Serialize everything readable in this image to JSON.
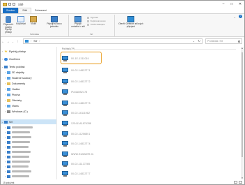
{
  "window": {
    "title": "Sítě"
  },
  "ribbon": {
    "tabs": [
      "Soubor",
      "Sítě",
      "Zobrazení"
    ],
    "buttons": {
      "pin": "Připnout k panelu Rychlý přístup",
      "copy": "Kopírovat",
      "paste": "Vložit",
      "map": "Připojit síťovou jednotku",
      "map2": "Připojit umístění v síti",
      "properties": "Vlastnosti",
      "network": "Otevřít Centrum síťových připojení"
    },
    "small_items": [
      "Vyjmout",
      "Kopírovat cestu",
      "Vložit zástupce"
    ],
    "groups": [
      "Schránka",
      "Síť"
    ]
  },
  "address": {
    "path": "Síť",
    "search_placeholder": "Prohledat: Síť"
  },
  "nav": {
    "items": [
      {
        "label": "Rychlý přístup",
        "icon": "star-icon"
      },
      {
        "label": "OneDrive",
        "icon": "cloud-icon"
      },
      {
        "label": "Tento počítač",
        "icon": "computer-icon"
      },
      {
        "label": "3D objekty",
        "icon": "folder-icon"
      },
      {
        "label": "Stažené soubory",
        "icon": "download-folder-icon"
      },
      {
        "label": "Dokumenty",
        "icon": "documents-folder-icon"
      },
      {
        "label": "Hudba",
        "icon": "music-folder-icon"
      },
      {
        "label": "Plocha",
        "icon": "desktop-folder-icon"
      },
      {
        "label": "Obrázky",
        "icon": "pictures-folder-icon"
      },
      {
        "label": "Videa",
        "icon": "videos-folder-icon"
      },
      {
        "label": "Windows (C:)",
        "icon": "drive-icon"
      },
      {
        "label": "Síť",
        "icon": "network-icon"
      }
    ]
  },
  "content": {
    "group_header": "Počítač (15)",
    "computers": [
      {
        "name": "00-1E-1311010"
      },
      {
        "name": "00-02-14822771"
      },
      {
        "name": "00-02-14822772"
      },
      {
        "name": "IPA4A8B2178"
      },
      {
        "name": "00-02-14822773"
      },
      {
        "name": "00-02-16111982"
      },
      {
        "name": "123411A1876398"
      },
      {
        "name": "00-02-11256801"
      },
      {
        "name": "00-02-14822774"
      },
      {
        "name": "WWW.SUMMER.01"
      },
      {
        "name": "00-02-11127265"
      },
      {
        "name": "00-02-14822777"
      }
    ]
  },
  "status": {
    "count": "15 položek"
  }
}
